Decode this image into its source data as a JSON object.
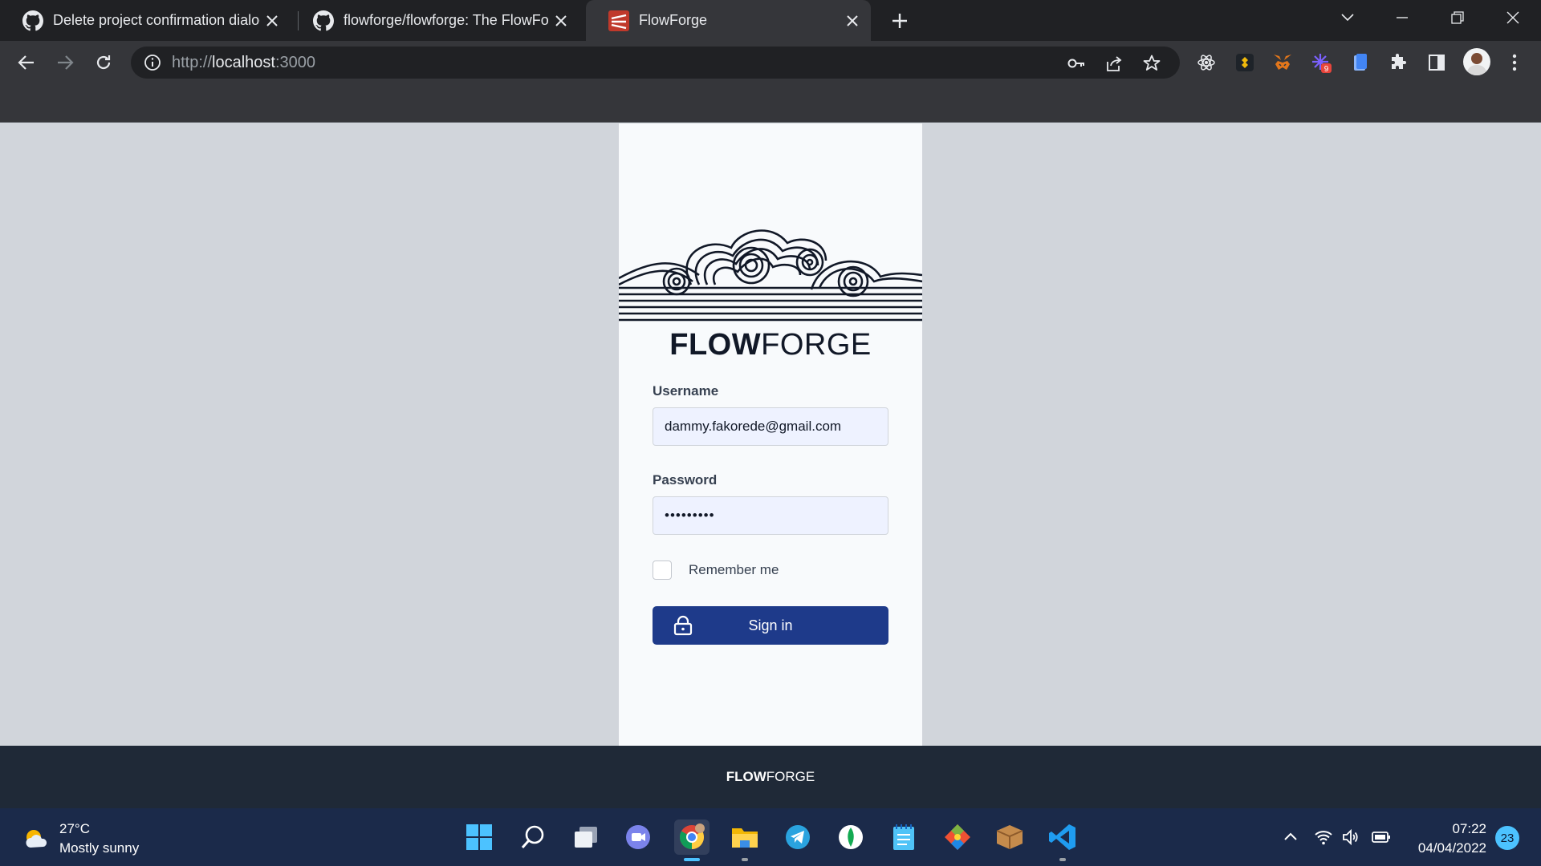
{
  "browser": {
    "tabs": [
      {
        "title": "Delete project confirmation dialog",
        "favicon": "github-icon",
        "active": false
      },
      {
        "title": "flowforge/flowforge: The FlowForge",
        "favicon": "github-icon",
        "active": false
      },
      {
        "title": "FlowForge",
        "favicon": "flowforge-icon",
        "active": true
      }
    ],
    "address": {
      "scheme": "http://",
      "host": "localhost",
      "port": ":3000"
    }
  },
  "login": {
    "brand_bold": "FLOW",
    "brand_light": "FORGE",
    "username_label": "Username",
    "username_value": "dammy.fakorede@gmail.com",
    "password_label": "Password",
    "password_value": "•••••••••",
    "remember_label": "Remember me",
    "remember_checked": false,
    "signin_label": "Sign in"
  },
  "footer": {
    "brand_bold": "FLOW",
    "brand_light": "FORGE"
  },
  "taskbar": {
    "weather_temp": "27°C",
    "weather_desc": "Mostly sunny",
    "time": "07:22",
    "date": "04/04/2022",
    "notification_count": "23",
    "extension_badge": "9"
  },
  "colors": {
    "primary": "#1e3a8a",
    "page_bg": "#d1d5db",
    "card_bg": "#f8fafc",
    "footer_bg": "#1f2937",
    "input_bg": "#eef2ff"
  }
}
